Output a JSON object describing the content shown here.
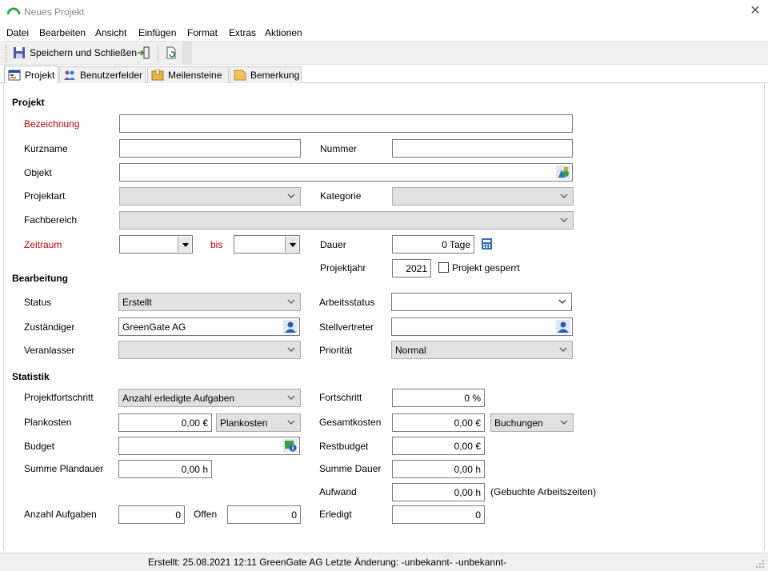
{
  "window": {
    "title": "Neues Projekt"
  },
  "menu": [
    "Datei",
    "Bearbeiten",
    "Ansicht",
    "Einfügen",
    "Format",
    "Extras",
    "Aktionen"
  ],
  "toolbar": {
    "save_close_label": "Speichern und Schließen"
  },
  "tabs": [
    {
      "label": "Projekt",
      "icon": "project-icon",
      "active": true
    },
    {
      "label": "Benutzerfelder",
      "icon": "users-icon"
    },
    {
      "label": "Meilensteine",
      "icon": "milestone-icon"
    },
    {
      "label": "Bemerkung",
      "icon": "note-icon"
    }
  ],
  "projekt": {
    "section_title": "Projekt",
    "bezeichnung_label": "Bezeichnung",
    "bezeichnung_value": "",
    "kurzname_label": "Kurzname",
    "kurzname_value": "",
    "nummer_label": "Nummer",
    "nummer_value": "",
    "objekt_label": "Objekt",
    "objekt_value": "",
    "projektart_label": "Projektart",
    "projektart_value": "",
    "kategorie_label": "Kategorie",
    "kategorie_value": "",
    "fachbereich_label": "Fachbereich",
    "fachbereich_value": "",
    "zeitraum_label": "Zeitraum",
    "bis_label": "bis",
    "dauer_label": "Dauer",
    "dauer_value": "0 Tage",
    "projektjahr_label": "Projektjahr",
    "projektjahr_value": "2021",
    "gesperrt_label": "Projekt gesperrt",
    "gesperrt_checked": false
  },
  "bearbeitung": {
    "section_title": "Bearbeitung",
    "status_label": "Status",
    "status_value": "Erstellt",
    "arbeitsstatus_label": "Arbeitsstatus",
    "arbeitsstatus_value": "",
    "zustaendiger_label": "Zuständiger",
    "zustaendiger_value": "GreenGate AG",
    "stellvertreter_label": "Stellvertreter",
    "stellvertreter_value": "",
    "veranlasser_label": "Veranlasser",
    "veranlasser_value": "",
    "prioritaet_label": "Priorität",
    "prioritaet_value": "Normal"
  },
  "statistik": {
    "section_title": "Statistik",
    "projektfortschritt_label": "Projektfortschritt",
    "projektfortschritt_value": "Anzahl erledigte Aufgaben",
    "fortschritt_label": "Fortschritt",
    "fortschritt_value": "0 %",
    "plankosten_label": "Plankosten",
    "plankosten_value": "0,00 €",
    "plankosten_type": "Plankosten",
    "gesamtkosten_label": "Gesamtkosten",
    "gesamtkosten_value": "0,00 €",
    "gesamtkosten_type": "Buchungen",
    "budget_label": "Budget",
    "budget_value": "",
    "restbudget_label": "Restbudget",
    "restbudget_value": "0,00 €",
    "summe_plandauer_label": "Summe Plandauer",
    "summe_plandauer_value": "0,00 h",
    "summe_dauer_label": "Summe Dauer",
    "summe_dauer_value": "0,00 h",
    "aufwand_label": "Aufwand",
    "aufwand_value": "0,00 h",
    "aufwand_note": "(Gebuchte Arbeitszeiten)",
    "anzahl_aufgaben_label": "Anzahl Aufgaben",
    "anzahl_aufgaben_value": "0",
    "offen_label": "Offen",
    "offen_value": "0",
    "erledigt_label": "Erledigt",
    "erledigt_value": "0"
  },
  "statusbar": {
    "text": "Erstellt: 25.08.2021 12:11 GreenGate AG  Letzte Änderung: -unbekannt- -unbekannt-"
  }
}
